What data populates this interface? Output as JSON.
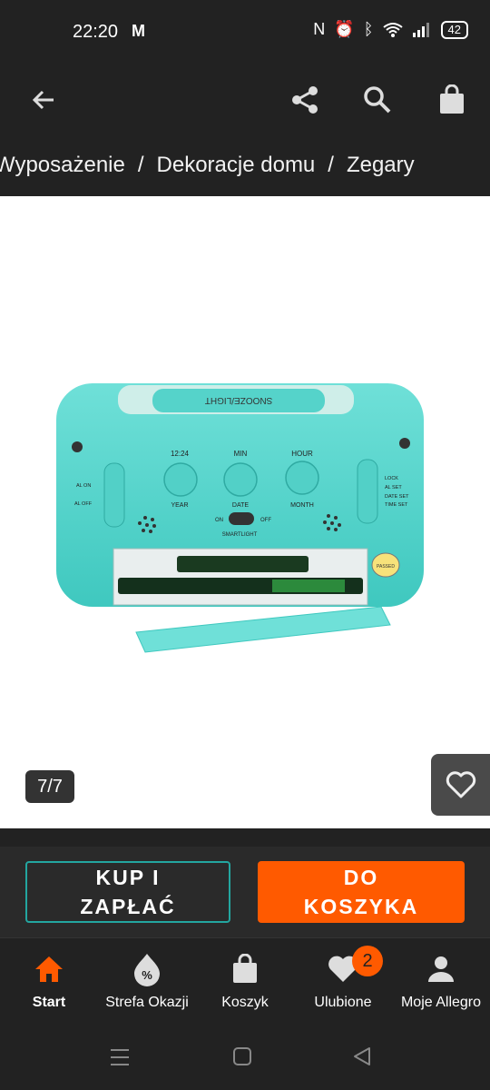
{
  "status": {
    "time": "22:20",
    "battery": "42"
  },
  "breadcrumb": [
    "Wyposażenie",
    "Dekoracje domu",
    "Zegary"
  ],
  "breadcrumb_sep": "/",
  "gallery": {
    "counter": "7/7"
  },
  "actions": {
    "buy_line1": "KUP I",
    "buy_line2": "ZAPŁAĆ",
    "cart_line1": "DO",
    "cart_line2": "KOSZYKA"
  },
  "nav": {
    "start": "Start",
    "deals": "Strefa Okazji",
    "cart": "Koszyk",
    "favorites": "Ulubione",
    "favorites_badge": "2",
    "account": "Moje Allegro"
  },
  "clock_labels": {
    "brand": "SNOOZE/LIGHT",
    "t1224": "12:24",
    "min": "MIN",
    "hour": "HOUR",
    "year": "YEAR",
    "date": "DATE",
    "month": "MONTH",
    "on": "ON",
    "off": "OFF",
    "smartlight": "SMARTLIGHT",
    "al_on": "AL ON",
    "al_off": "AL OFF",
    "lock": "LOCK",
    "al_set": "AL SET",
    "date_set": "DATE SET",
    "time_set": "TIME SET",
    "passed": "PASSED"
  },
  "colors": {
    "accent": "#ff5a00",
    "teal": "#23a6a0"
  }
}
